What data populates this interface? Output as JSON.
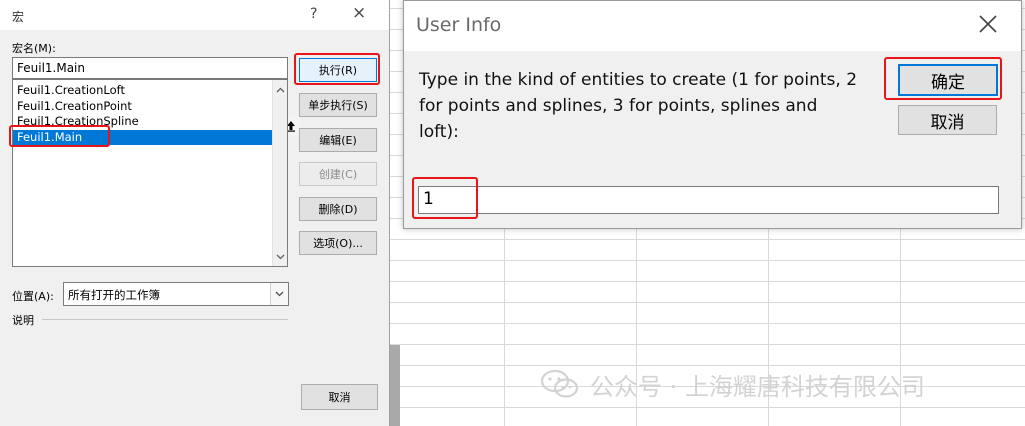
{
  "macro_dialog": {
    "title": "宏",
    "help": "?",
    "close": "×",
    "name_label": "宏名(M):",
    "name_value": "Feuil1.Main",
    "items": [
      "Feuil1.CreationLoft",
      "Feuil1.CreationPoint",
      "Feuil1.CreationSpline",
      "Feuil1.Main"
    ],
    "selected_item": "Feuil1.Main",
    "buttons": {
      "run": "执行(R)",
      "step": "单步执行(S)",
      "edit": "编辑(E)",
      "create": "创建(C)",
      "delete": "删除(D)",
      "options": "选项(O)..."
    },
    "location_label": "位置(A):",
    "location_value": "所有打开的工作簿",
    "description_label": "说明",
    "cancel": "取消"
  },
  "user_info": {
    "title": "User Info",
    "prompt": "Type in the kind of entities to create (1 for points, 2 for points and splines, 3 for points, splines and loft):",
    "ok": "确定",
    "cancel": "取消",
    "input_value": "1"
  },
  "watermark": {
    "text": "公众号 · 上海耀唐科技有限公司"
  },
  "colors": {
    "highlight_red": "#e8141a",
    "selection_blue": "#0078d7",
    "dialog_bg": "#f0f0f0"
  },
  "icons": {
    "upload": "upload-arrow-icon",
    "scroll_up": "chevron-up-icon",
    "scroll_down": "chevron-down-icon",
    "dropdown": "chevron-down-icon",
    "close": "close-icon",
    "watermark": "wechat-icon"
  }
}
